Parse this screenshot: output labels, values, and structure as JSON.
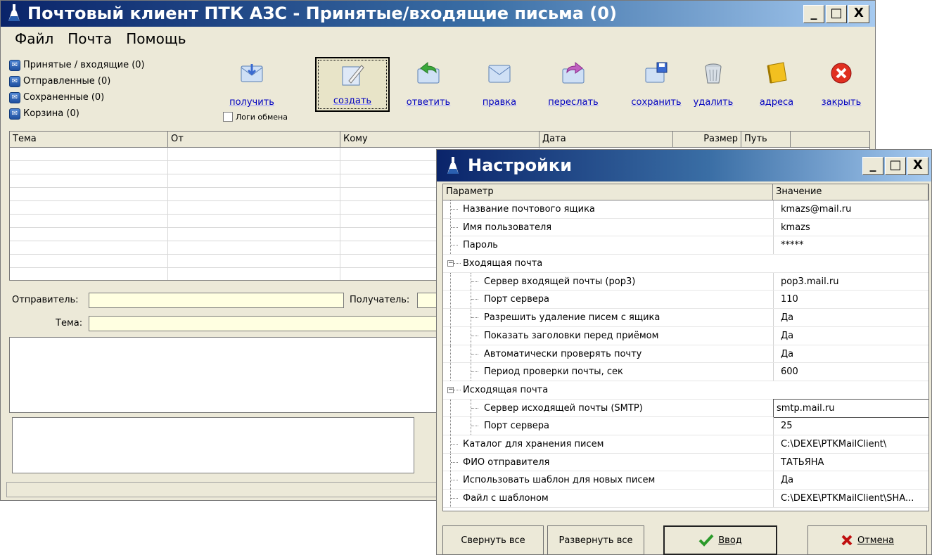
{
  "main_window": {
    "title": "Почтовый клиент ПТК АЗС -  Принятые/входящие письма (0)",
    "window_buttons": {
      "minimize": "_",
      "maximize": "□",
      "close": "X"
    },
    "menu": [
      "Файл",
      "Почта",
      "Помощь"
    ]
  },
  "folders": [
    "Принятые / входящие (0)",
    "Отправленные (0)",
    "Сохраненные (0)",
    "Корзина (0)"
  ],
  "toolbar": {
    "receive": "получить",
    "create": "создать",
    "reply": "ответить",
    "edit": "правка",
    "forward": "переслать",
    "save": "сохранить",
    "delete": "удалить",
    "addresses": "адреса",
    "close": "закрыть",
    "log_checkbox": "Логи обмена"
  },
  "message_list": {
    "columns": [
      "Тема",
      "От",
      "Кому",
      "Дата",
      "Размер",
      "Путь"
    ]
  },
  "compose": {
    "sender_label": "Отправитель:",
    "recipient_label": "Получатель:",
    "subject_label": "Тема:"
  },
  "settings": {
    "title": "Настройки",
    "window_buttons": {
      "minimize": "_",
      "maximize": "□",
      "close": "X"
    },
    "columns": {
      "param": "Параметр",
      "value": "Значение"
    },
    "rows": [
      {
        "name": "Название почтового ящика",
        "value": "kmazs@mail.ru"
      },
      {
        "name": "Имя пользователя",
        "value": "kmazs"
      },
      {
        "name": "Пароль",
        "value": "*****"
      },
      {
        "name": "Входящая почта",
        "value": ""
      },
      {
        "name": "Сервер входящей почты (pop3)",
        "value": "pop3.mail.ru"
      },
      {
        "name": "Порт сервера",
        "value": "110"
      },
      {
        "name": "Разрешить удаление писем с ящика",
        "value": "Да"
      },
      {
        "name": "Показать заголовки перед приёмом",
        "value": "Да"
      },
      {
        "name": "Автоматически проверять почту",
        "value": "Да"
      },
      {
        "name": "Период проверки почты, сек",
        "value": "600"
      },
      {
        "name": "Исходящая почта",
        "value": ""
      },
      {
        "name": "Сервер исходящей почты (SMTP)",
        "value": "smtp.mail.ru"
      },
      {
        "name": "Порт сервера",
        "value": "25"
      },
      {
        "name": "Каталог для хранения писем",
        "value": "C:\\DEXE\\PTKMailClient\\"
      },
      {
        "name": "ФИО отправителя",
        "value": "ТАТЬЯНА"
      },
      {
        "name": "Использовать шаблон для новых писем",
        "value": "Да"
      },
      {
        "name": "Файл с шаблоном",
        "value": "C:\\DEXE\\PTKMailClient\\SHA..."
      }
    ],
    "buttons": {
      "collapse_all": "Свернуть все",
      "expand_all": "Развернуть все",
      "ok": "Ввод",
      "cancel": "Отмена"
    }
  },
  "colors": {
    "title_gradient_start": "#0a246a",
    "title_gradient_end": "#a6caf0",
    "field_yellow": "#ffffe1",
    "link_blue": "#0000c0"
  }
}
